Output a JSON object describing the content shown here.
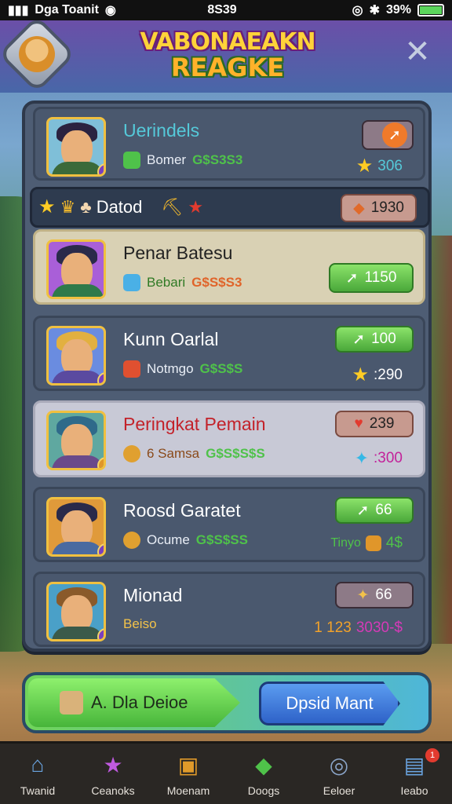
{
  "status": {
    "carrier": "Dga Toanit",
    "time": "8S39",
    "battery": "39%"
  },
  "header": {
    "title_line1": "VABONAEAKN",
    "title_line2": "REAGKE"
  },
  "rows": [
    {
      "name": "Uerindels",
      "tag": "Bomer",
      "money": "G$S3S3",
      "score": "306",
      "name_color": "#55c9d9",
      "pill": ""
    },
    {
      "name": "Penar Batesu",
      "tag": "Bebari",
      "money": "G$S$S3",
      "pill": "1150",
      "name_color": "#222222"
    },
    {
      "name": "Kunn Oarlal",
      "tag": "Notmgo",
      "money": "G$S$S",
      "pill": "100",
      "score": ":290",
      "name_color": "#ffffff"
    },
    {
      "name": "Peringkat Pemain",
      "tag": "6 Samsa",
      "money": "G$S$S$S",
      "pill": "239",
      "score": ":300",
      "name_color": "#c3222a"
    },
    {
      "name": "Roosd Garatet",
      "tag": "Ocume",
      "money": "G$S$SS",
      "pill": "66",
      "score": "4$",
      "score_label": "Tinyo",
      "name_color": "#ffffff"
    },
    {
      "name": "Mionad",
      "tag": "Beiso",
      "money": "",
      "pill": "66",
      "score": "3030-$",
      "score_label": "1 123",
      "name_color": "#ffffff"
    }
  ],
  "rankbar": {
    "label": "Datod",
    "value": "1930"
  },
  "action": {
    "left": "A. Dla Deioe",
    "right": "Dpsid Mant"
  },
  "colors": {
    "accent": "#4aa83a",
    "gold": "#ffcc24"
  },
  "nav": [
    {
      "label": "Twanid",
      "icon": "home-icon"
    },
    {
      "label": "Ceanoks",
      "icon": "star-icon"
    },
    {
      "label": "Moenam",
      "icon": "chest-icon"
    },
    {
      "label": "Doogs",
      "icon": "gem-icon"
    },
    {
      "label": "Eeloer",
      "icon": "compass-icon"
    },
    {
      "label": "Ieabo",
      "icon": "inbox-icon",
      "badge": "1"
    }
  ]
}
